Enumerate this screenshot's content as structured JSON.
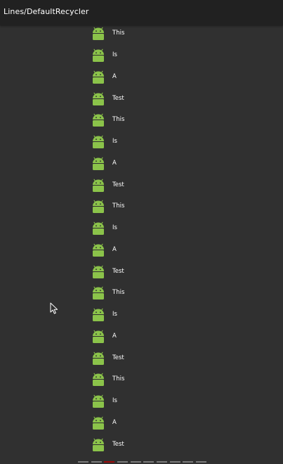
{
  "app_bar": {
    "title": "Lines/DefaultRecycler"
  },
  "list": {
    "item_icon": "android-robot-icon",
    "items": [
      {
        "label": "This"
      },
      {
        "label": "Is"
      },
      {
        "label": "A"
      },
      {
        "label": "Test"
      },
      {
        "label": "This"
      },
      {
        "label": "Is"
      },
      {
        "label": "A"
      },
      {
        "label": "Test"
      },
      {
        "label": "This"
      },
      {
        "label": "Is"
      },
      {
        "label": "A"
      },
      {
        "label": "Test"
      },
      {
        "label": "This"
      },
      {
        "label": "Is"
      },
      {
        "label": "A"
      },
      {
        "label": "Test"
      },
      {
        "label": "This"
      },
      {
        "label": "Is"
      },
      {
        "label": "A"
      },
      {
        "label": "Test"
      }
    ]
  },
  "pager": {
    "page_count": 10,
    "active_index": 2
  },
  "colors": {
    "background": "#303030",
    "app_bar": "#212121",
    "android_green": "#8bc34a",
    "pager_inactive": "#7a7a7a",
    "pager_active": "#9b0a0a"
  }
}
